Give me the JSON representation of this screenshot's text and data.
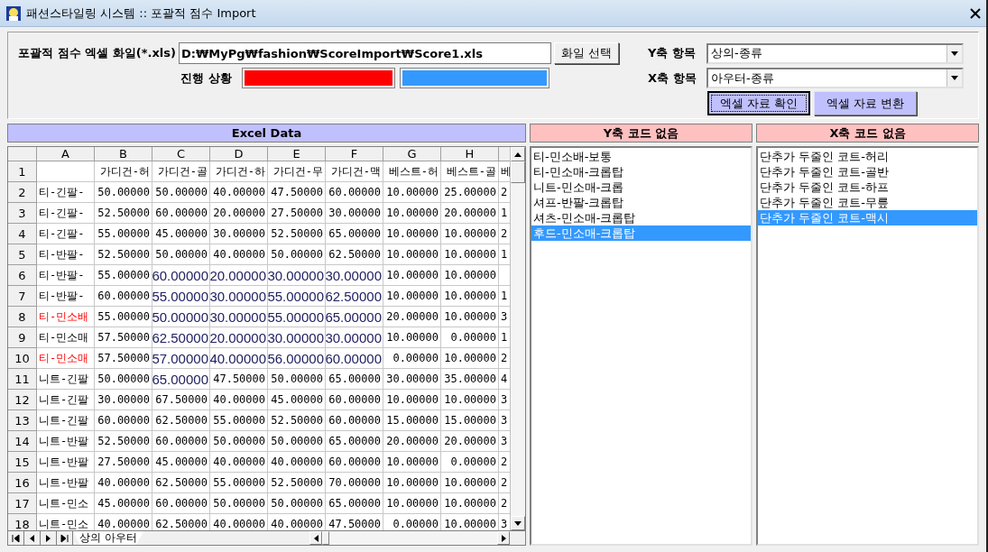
{
  "window": {
    "title": "패션스타일링 시스템 :: 포괄적 점수 Import"
  },
  "file_row": {
    "label": "포괄적 점수 엑셀 화일(*.xls)",
    "value": "D:₩MyPg₩fashion₩ScoreImport₩Score1.xls",
    "button": "화일 선택"
  },
  "progress": {
    "label": "진행 상황",
    "bars": [
      {
        "level": 1,
        "color": "#ff0000"
      },
      {
        "level": 1,
        "color": "#3399ff"
      }
    ]
  },
  "axes": [
    {
      "label": "Y축 항목",
      "value": "상의-종류"
    },
    {
      "label": "X축 항목",
      "value": "아우터-종류"
    }
  ],
  "actions": [
    {
      "label": "엑셀 자료 확인",
      "focused": true
    },
    {
      "label": "엑셀 자료 변환",
      "focused": false
    }
  ],
  "excel": {
    "header": "Excel Data",
    "columns": [
      "A",
      "B",
      "C",
      "D",
      "E",
      "F",
      "G",
      "H",
      null
    ],
    "rows": [
      {
        "number": "1",
        "cells": [
          null,
          "가디건-허",
          "가디건-골",
          "가디건-하",
          "가디건-무",
          "가디건-맥",
          "베스트-허",
          "베스트-골",
          "베"
        ]
      },
      {
        "number": "2",
        "cells": [
          "티-긴팔-",
          "50.00000",
          "50.00000",
          "40.00000",
          "47.50000",
          "60.00000",
          "10.00000",
          "25.00000",
          "2"
        ]
      },
      {
        "number": "3",
        "cells": [
          "티-긴팔-",
          "52.50000",
          "60.00000",
          "20.00000",
          "27.50000",
          "30.00000",
          "10.00000",
          "20.00000",
          "1"
        ]
      },
      {
        "number": "4",
        "cells": [
          "티-긴팔-",
          "55.00000",
          "45.00000",
          "30.00000",
          "52.50000",
          "65.00000",
          "10.00000",
          "10.00000",
          "2"
        ]
      },
      {
        "number": "5",
        "cells": [
          "티-반팔-",
          "52.50000",
          "50.00000",
          "40.00000",
          "50.00000",
          "62.50000",
          "10.00000",
          "10.00000",
          "1"
        ]
      },
      {
        "number": "6",
        "cells": [
          "티-반팔-",
          "55.00000",
          {
            "text": "60.00000",
            "emphasis": true
          },
          {
            "text": "20.00000",
            "emphasis": true
          },
          {
            "text": "30.00000",
            "emphasis": true
          },
          {
            "text": "30.00000",
            "emphasis": true
          },
          "10.00000",
          "10.00000",
          null
        ]
      },
      {
        "number": "7",
        "cells": [
          "티-반팔-",
          "60.00000",
          {
            "text": "55.00000",
            "emphasis": true
          },
          {
            "text": "30.00000",
            "emphasis": true
          },
          {
            "text": "55.00000",
            "emphasis": true
          },
          {
            "text": "62.50000",
            "emphasis": true
          },
          "10.00000",
          "10.00000",
          "1"
        ]
      },
      {
        "number": "8",
        "cells": [
          {
            "text": "티-민소배",
            "flagged": true
          },
          "55.00000",
          {
            "text": "50.00000",
            "emphasis": true
          },
          {
            "text": "30.00000",
            "emphasis": true
          },
          {
            "text": "55.00000",
            "emphasis": true
          },
          {
            "text": "65.00000",
            "emphasis": true
          },
          "20.00000",
          "10.00000",
          "3"
        ]
      },
      {
        "number": "9",
        "cells": [
          "티-민소매",
          "57.50000",
          {
            "text": "62.50000",
            "emphasis": true
          },
          {
            "text": "20.00000",
            "emphasis": true
          },
          {
            "text": "30.00000",
            "emphasis": true
          },
          {
            "text": "30.00000",
            "emphasis": true
          },
          "10.00000",
          "0.00000",
          "1"
        ]
      },
      {
        "number": "10",
        "cells": [
          {
            "text": "티-민소매",
            "flagged": true
          },
          "57.50000",
          {
            "text": "57.00000",
            "emphasis": true
          },
          {
            "text": "40.00000",
            "emphasis": true
          },
          {
            "text": "56.00000",
            "emphasis": true
          },
          {
            "text": "60.00000",
            "emphasis": true
          },
          "0.00000",
          "10.00000",
          "2"
        ]
      },
      {
        "number": "11",
        "cells": [
          "니트-긴팔",
          "50.00000",
          {
            "text": "65.00000",
            "emphasis": true
          },
          "47.50000",
          "50.00000",
          "65.00000",
          "30.00000",
          "35.00000",
          "4"
        ]
      },
      {
        "number": "12",
        "cells": [
          "니트-긴팔",
          "30.00000",
          "67.50000",
          "40.00000",
          "45.00000",
          "60.00000",
          "10.00000",
          "10.00000",
          "3"
        ]
      },
      {
        "number": "13",
        "cells": [
          "니트-긴팔",
          "60.00000",
          "62.50000",
          "55.00000",
          "52.50000",
          "60.00000",
          "15.00000",
          "15.00000",
          "3"
        ]
      },
      {
        "number": "14",
        "cells": [
          "니트-반팔",
          "52.50000",
          "60.00000",
          "50.00000",
          "50.00000",
          "65.00000",
          "20.00000",
          "20.00000",
          "3"
        ]
      },
      {
        "number": "15",
        "cells": [
          "니트-반팔",
          "27.50000",
          "45.00000",
          "40.00000",
          "40.00000",
          "60.00000",
          "10.00000",
          "0.00000",
          "2"
        ]
      },
      {
        "number": "16",
        "cells": [
          "니트-반팔",
          "40.00000",
          "62.50000",
          "55.00000",
          "52.50000",
          "70.00000",
          "10.00000",
          "10.00000",
          "2"
        ]
      },
      {
        "number": "17",
        "cells": [
          "니트-민소",
          "45.00000",
          "60.00000",
          "50.00000",
          "50.00000",
          "65.00000",
          "10.00000",
          "10.00000",
          "2"
        ]
      },
      {
        "number": "18",
        "cells": [
          "니트-민소",
          "40.00000",
          "62.50000",
          "40.00000",
          "40.00000",
          "47.50000",
          "0.00000",
          "10.00000",
          "3"
        ]
      }
    ],
    "sheet_tabs": [
      {
        "label": "상의 아우터",
        "selected": true
      }
    ]
  },
  "lists": [
    {
      "header": "Y축 코드 없음",
      "items": [
        {
          "text": "티-민소배-보통",
          "selected": false
        },
        {
          "text": "티-민소매-크롭탑",
          "selected": false
        },
        {
          "text": "니트-민소매-크롭",
          "selected": false
        },
        {
          "text": "셔프-반팔-크롭탑",
          "selected": false
        },
        {
          "text": "셔츠-민소매-크롭탑",
          "selected": false
        },
        {
          "text": "후드-민소매-크롭탑",
          "selected": true
        }
      ]
    },
    {
      "header": "X축 코드 없음",
      "items": [
        {
          "text": "단추가 두줄인 코트-허리",
          "selected": false
        },
        {
          "text": "단추가 두줄인 코트-골반",
          "selected": false
        },
        {
          "text": "단추가 두줄인 코트-하프",
          "selected": false
        },
        {
          "text": "단추가 두줄인 코트-무릎",
          "selected": false
        },
        {
          "text": "단추가 두줄인 코트-맥시",
          "selected": true
        }
      ]
    }
  ]
}
